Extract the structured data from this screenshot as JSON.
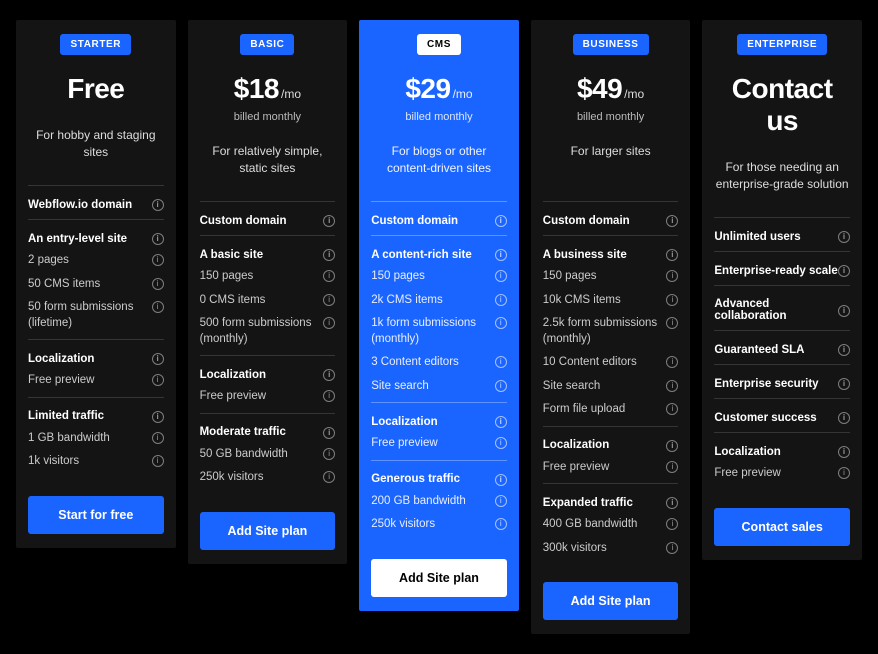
{
  "plans": [
    {
      "badge": "STARTER",
      "price": "Free",
      "per": "",
      "billed": "",
      "desc": "For hobby and staging sites",
      "sections": [
        {
          "title": "Webflow.io domain",
          "items": []
        },
        {
          "title": "An entry-level site",
          "items": [
            "2 pages",
            "50 CMS items",
            "50 form submissions (lifetime)"
          ]
        },
        {
          "title": "Localization",
          "items": [
            "Free preview"
          ]
        },
        {
          "title": "Limited traffic",
          "items": [
            "1 GB bandwidth",
            "1k visitors"
          ]
        }
      ],
      "cta": "Start for free"
    },
    {
      "badge": "BASIC",
      "price": "$18",
      "per": "/mo",
      "billed": "billed monthly",
      "desc": "For relatively simple, static sites",
      "sections": [
        {
          "title": "Custom domain",
          "items": []
        },
        {
          "title": "A basic site",
          "items": [
            "150 pages",
            "0 CMS items",
            "500 form submissions (monthly)"
          ]
        },
        {
          "title": "Localization",
          "items": [
            "Free preview"
          ]
        },
        {
          "title": "Moderate traffic",
          "items": [
            "50 GB bandwidth",
            "250k visitors"
          ]
        }
      ],
      "cta": "Add Site plan"
    },
    {
      "badge": "CMS",
      "price": "$29",
      "per": "/mo",
      "billed": "billed monthly",
      "desc": "For blogs or other content-driven sites",
      "highlight": true,
      "sections": [
        {
          "title": "Custom domain",
          "items": []
        },
        {
          "title": "A content-rich site",
          "items": [
            "150 pages",
            "2k CMS items",
            "1k form submissions (monthly)",
            "3 Content editors",
            "Site search"
          ]
        },
        {
          "title": "Localization",
          "items": [
            "Free preview"
          ]
        },
        {
          "title": "Generous traffic",
          "items": [
            "200 GB bandwidth",
            "250k visitors"
          ]
        }
      ],
      "cta": "Add Site plan"
    },
    {
      "badge": "BUSINESS",
      "price": "$49",
      "per": "/mo",
      "billed": "billed monthly",
      "desc": "For larger sites",
      "sections": [
        {
          "title": "Custom domain",
          "items": []
        },
        {
          "title": "A business site",
          "items": [
            "150 pages",
            "10k CMS items",
            "2.5k form submissions (monthly)",
            "10 Content editors",
            "Site search",
            "Form file upload"
          ]
        },
        {
          "title": "Localization",
          "items": [
            "Free preview"
          ]
        },
        {
          "title": "Expanded traffic",
          "items": [
            "400 GB bandwidth",
            "300k visitors"
          ]
        }
      ],
      "cta": "Add Site plan"
    },
    {
      "badge": "ENTERPRISE",
      "price": "Contact us",
      "per": "",
      "billed": "",
      "desc": "For those needing an enterprise-grade solution",
      "sections": [
        {
          "title": "Unlimited users",
          "items": []
        },
        {
          "title": "Enterprise-ready scale",
          "items": []
        },
        {
          "title": "Advanced collaboration",
          "items": []
        },
        {
          "title": "Guaranteed SLA",
          "items": []
        },
        {
          "title": "Enterprise security",
          "items": []
        },
        {
          "title": "Customer success",
          "items": []
        },
        {
          "title": "Localization",
          "items": [
            "Free preview"
          ]
        }
      ],
      "cta": "Contact sales"
    }
  ]
}
